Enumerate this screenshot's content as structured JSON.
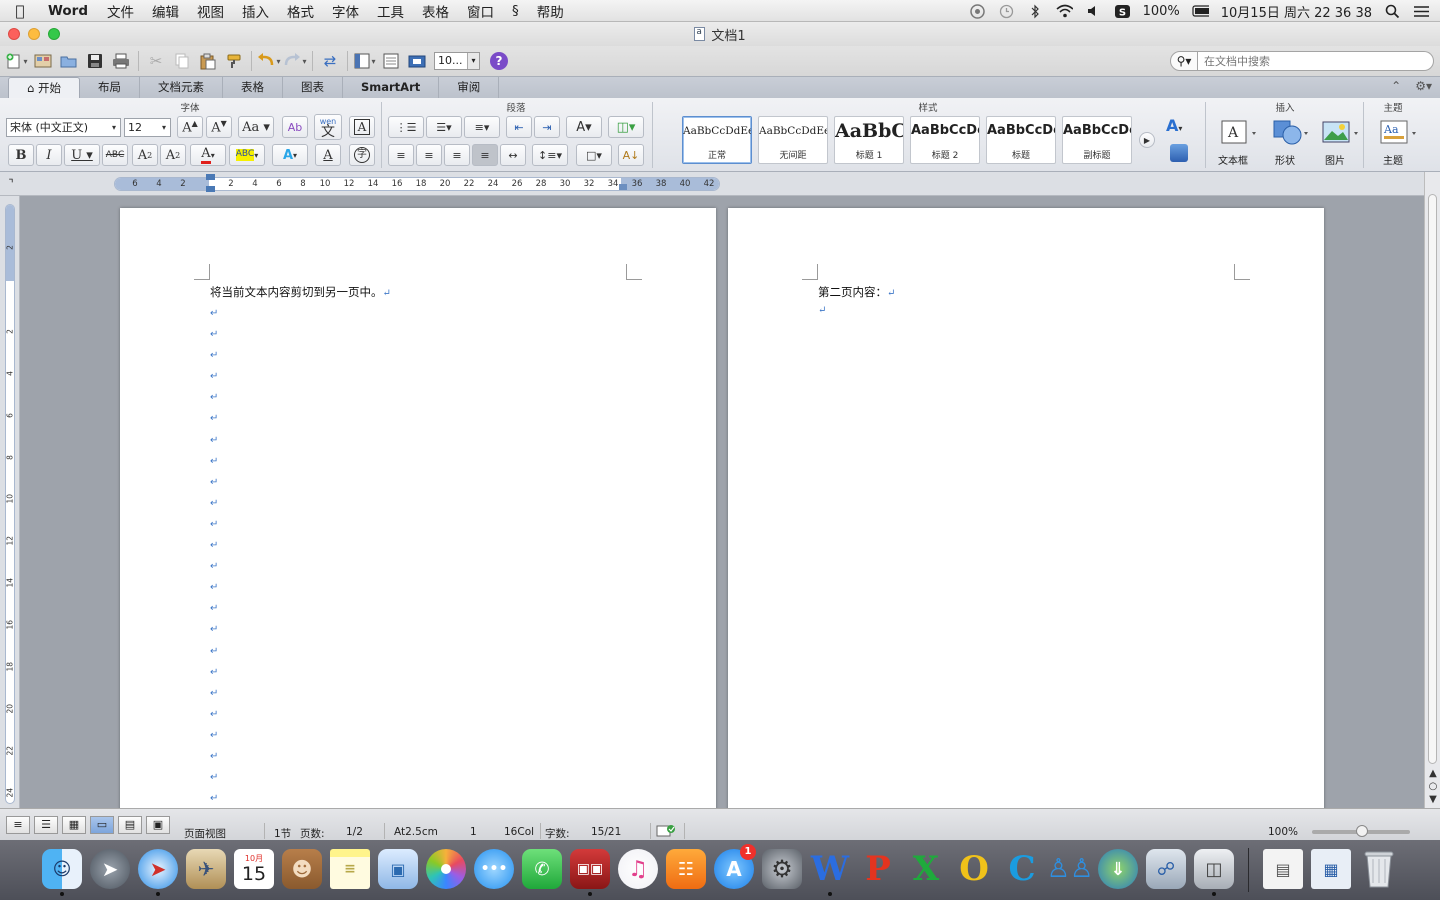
{
  "menubar": {
    "app_name": "Word",
    "items": [
      "文件",
      "编辑",
      "视图",
      "插入",
      "格式",
      "字体",
      "工具",
      "表格",
      "窗口",
      "帮助"
    ],
    "battery": "100%",
    "datetime": "10月15日 周六  22 36 38"
  },
  "window": {
    "title": "文档1"
  },
  "toolbar": {
    "zoom_value": "10...",
    "search_placeholder": "在文档中搜索"
  },
  "ribbon_tabs": [
    "开始",
    "布局",
    "文档元素",
    "表格",
    "图表",
    "SmartArt",
    "审阅"
  ],
  "ribbon": {
    "groups": {
      "font": "字体",
      "paragraph": "段落",
      "styles": "样式",
      "insert": "插入",
      "theme": "主题"
    },
    "font_name": "宋体 (中文正文)",
    "font_size": "12",
    "styles": [
      {
        "sample": "AaBbCcDdEe",
        "name": "正常"
      },
      {
        "sample": "AaBbCcDdEe",
        "name": "无间距"
      },
      {
        "sample": "AaBbC",
        "name": "标题 1"
      },
      {
        "sample": "AaBbCcDc",
        "name": "标题 2"
      },
      {
        "sample": "AaBbCcDc",
        "name": "标题"
      },
      {
        "sample": "AaBbCcDc",
        "name": "副标题"
      }
    ],
    "insert_items": [
      "文本框",
      "形状",
      "图片"
    ],
    "theme_label": "主题",
    "phonetic": "wen",
    "phonetic_char": "文"
  },
  "ruler": {
    "ticks": [
      "6",
      "4",
      "2",
      "2",
      "4",
      "6",
      "8",
      "10",
      "12",
      "14",
      "16",
      "18",
      "20",
      "22",
      "24",
      "26",
      "28",
      "30",
      "32",
      "34",
      "36",
      "38",
      "40",
      "42"
    ],
    "vticks": [
      "2",
      "2",
      "4",
      "6",
      "8",
      "10",
      "12",
      "14",
      "16",
      "18",
      "20",
      "22",
      "24"
    ]
  },
  "document": {
    "page1_text": "将当前文本内容剪切到另一页中。",
    "page2_text": "第二页内容：",
    "para_mark": "↵"
  },
  "statusbar": {
    "view": "页面视图",
    "section": "1节",
    "pages_label": "页数:",
    "pages_value": "1/2",
    "at": "At2.5cm",
    "line": "1",
    "col": "16Col",
    "words_label": "字数:",
    "words_value": "15/21",
    "zoom": "100%"
  },
  "dock": {
    "calendar_month": "10月",
    "calendar_day": "15",
    "appstore_badge": "1"
  }
}
